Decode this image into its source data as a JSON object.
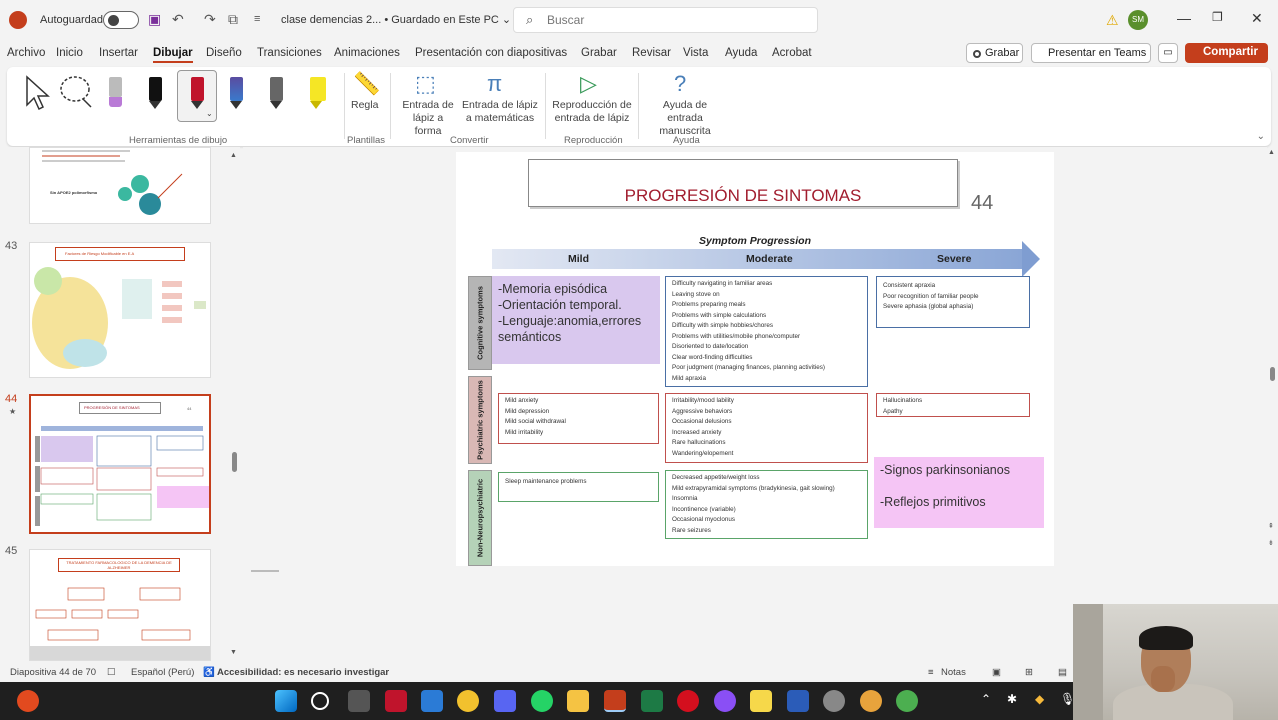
{
  "window": {
    "autosave_label": "Autoguardado",
    "doc_title": "clase demencias 2... • Guardado en Este PC ⌄",
    "search_placeholder": "Buscar",
    "user_initials": "SM"
  },
  "menu": [
    "Archivo",
    "Inicio",
    "Insertar",
    "Dibujar",
    "Diseño",
    "Transiciones",
    "Animaciones",
    "Presentación con diapositivas",
    "Grabar",
    "Revisar",
    "Vista",
    "Ayuda",
    "Acrobat"
  ],
  "menu_active": "Dibujar",
  "actions": {
    "grabar": "Grabar",
    "teams": "Presentar en Teams",
    "share": "Compartir"
  },
  "ribbon": {
    "groups": {
      "drawing_tools": "Herramientas de dibujo",
      "templates": "Plantillas",
      "convert": "Convertir",
      "playback": "Reproducción",
      "help": "Ayuda"
    },
    "ruler": "Regla",
    "ink_to_shape": "Entrada de lápiz a forma",
    "ink_to_math": "Entrada de lápiz a matemáticas",
    "ink_replay": "Reproducción de entrada de lápiz",
    "ink_help": "Ayuda de entrada manuscrita"
  },
  "thumbnails": {
    "slide43_num": "43",
    "slide43_title": "Factores de Riesgo Modificable en E.A",
    "slide44_num": "44",
    "slide44_title": "PROGRESIÓN DE SINTOMAS",
    "slide45_num": "45",
    "slide45_title": "TRATAMIENTO FARMACOLOGICO DE LA DEMENCIA DE ALZHEIMER",
    "slide42_text": "Sin APOE2 polimorfismo"
  },
  "slide": {
    "title": "PROGRESIÓN DE SINTOMAS",
    "number": "44",
    "chart_title": "Symptom Progression",
    "stages": [
      "Mild",
      "Moderate",
      "Severe"
    ],
    "row_labels": [
      "Cognitive symptoms",
      "Psychiatric symptoms",
      "Non-Neuropsychiatric"
    ],
    "cognitive_mild_note": [
      "-Memoria episódica",
      "-Orientación temporal.",
      "-Lenguaje:anomia,errores semánticos"
    ],
    "cognitive_moderate": [
      "Difficulty navigating in familiar areas",
      "Leaving stove on",
      "Problems preparing meals",
      "Problems with simple calculations",
      "Difficulty with simple hobbies/chores",
      "Problems with utilities/mobile phone/computer",
      "Disoriented to date/location",
      "Clear word-finding difficulties",
      "Poor judgment (managing finances, planning activities)",
      "Mild apraxia"
    ],
    "cognitive_severe": [
      "Consistent apraxia",
      "Poor recognition of familiar people",
      "Severe aphasia (global aphasia)"
    ],
    "psych_mild": [
      "Mild anxiety",
      "Mild depression",
      "Mild social withdrawal",
      "Mild irritability"
    ],
    "psych_moderate": [
      "Irritability/mood lability",
      "Aggressive behaviors",
      "Occasional delusions",
      "Increased anxiety",
      "Rare hallucinations",
      "Wandering/elopement"
    ],
    "psych_severe": [
      "Hallucinations",
      "Apathy"
    ],
    "nonneuro_mild": [
      "Sleep maintenance problems"
    ],
    "nonneuro_moderate": [
      "Decreased appetite/weight loss",
      "Mild extrapyramidal symptoms (bradykinesia, gait slowing)",
      "Insomnia",
      "Incontinence (variable)",
      "Occasional myoclonus",
      "Rare seizures"
    ],
    "severe_note": [
      "-Signos parkinsonianos",
      "-Reflejos primitivos"
    ]
  },
  "status": {
    "slide_count": "Diapositiva 44 de 70",
    "language": "Español (Perú)",
    "accessibility": "Accesibilidad: es necesario investigar",
    "notes": "Notas"
  }
}
